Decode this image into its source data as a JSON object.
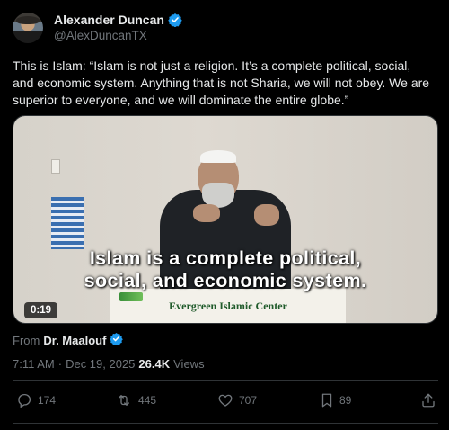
{
  "author": {
    "name": "Alexander Duncan",
    "handle": "@AlexDuncanTX"
  },
  "tweet": {
    "text": "This is Islam: “Islam is not just a religion. It’s a complete political, social, and economic system. Anything that is not Sharia, we will not obey. We are superior to everyone, and we will dominate the entire globe.”"
  },
  "media": {
    "caption_line1": "Islam is a complete political,",
    "caption_line2": "social, and economic system.",
    "podium_text": "Evergreen Islamic Center",
    "duration": "0:19"
  },
  "source": {
    "prefix": "From",
    "name": "Dr. Maalouf"
  },
  "meta": {
    "time": "7:11 AM",
    "separator": "·",
    "date": "Dec 19, 2025",
    "views_count": "26.4K",
    "views_label": "Views"
  },
  "actions": {
    "replies": "174",
    "reposts": "445",
    "likes": "707",
    "bookmarks": "89"
  },
  "colors": {
    "background": "#000000",
    "text": "#e7e9ea",
    "muted": "#71767b",
    "verified": "#1d9bf0",
    "divider": "#2f3336"
  },
  "icons": [
    "verified-badge-icon",
    "reply-icon",
    "repost-icon",
    "like-icon",
    "bookmark-icon",
    "share-icon"
  ]
}
